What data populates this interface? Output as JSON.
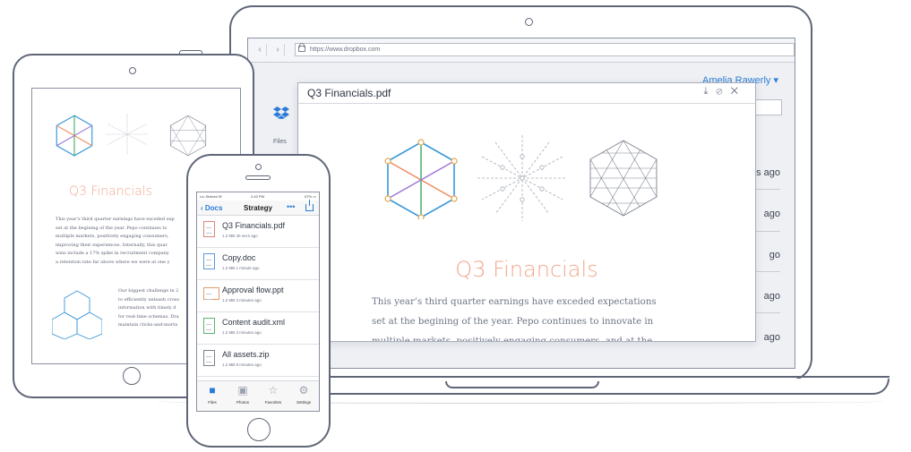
{
  "laptop": {
    "browser": {
      "back_glyph": "‹",
      "forward_glyph": "›",
      "url": "https://www.dropbox.com"
    },
    "user_menu": "Amelia Rawerly ▾",
    "sidebar_label": "Files",
    "background_rows": [
      "s ago",
      "ago",
      "go",
      "ago",
      "ago"
    ],
    "modal": {
      "title": "Q3 Financials.pdf",
      "actions": [
        "⤓",
        "⊘",
        "✕"
      ],
      "heading": "Q3 Financials",
      "body": [
        "This year’s third quarter earnings have exceded expectations",
        "set at the begining of the year. Pepo continues to innovate in",
        "multiple markets, positively engaging consumers, and at the"
      ]
    }
  },
  "tablet": {
    "heading": "Q3 Financials",
    "body": [
      "This year’s third quarter earnings have exceded exp",
      "set at the begining of the year. Pepo continues to",
      "multiple markets, positively engaging consumers,",
      "improving their experiences. Internally, this quar",
      "wins include a 17% spike in recruitment company",
      "a retention rate far above where we were at one y"
    ],
    "body2": [
      "Our biggest challenge in 2",
      "to efficiently unleash cross",
      "information with timely d",
      "for real-time schemas. Dra",
      "maintain clicks-and-morta"
    ]
  },
  "phone": {
    "status": {
      "carrier": "•••• Sixteen ✉",
      "time": "2:43 PM",
      "battery": "67% ▭"
    },
    "nav": {
      "back": "‹ Docs",
      "title": "Strategy",
      "more": "•••"
    },
    "files": [
      {
        "name": "Q3 Financials.pdf",
        "meta": "1.2 MB 30 secs ago"
      },
      {
        "name": "Copy.doc",
        "meta": "1.2 MB 1 minute ago"
      },
      {
        "name": "Approval flow.ppt",
        "meta": "1.2 MB 3 minutes ago"
      },
      {
        "name": "Content audit.xml",
        "meta": "1.2 MB 3 minutes ago"
      },
      {
        "name": "All assets.zip",
        "meta": "1.2 MB 9 minutes ago"
      }
    ],
    "tabs": [
      {
        "label": "Files",
        "glyph": "■"
      },
      {
        "label": "Photos",
        "glyph": "▣"
      },
      {
        "label": "Favorites",
        "glyph": "☆"
      },
      {
        "label": "Settings",
        "glyph": "⚙"
      }
    ]
  },
  "colors": {
    "accent": "#f2a68e",
    "link": "#2a7ad8",
    "outline": "#5f6677"
  }
}
